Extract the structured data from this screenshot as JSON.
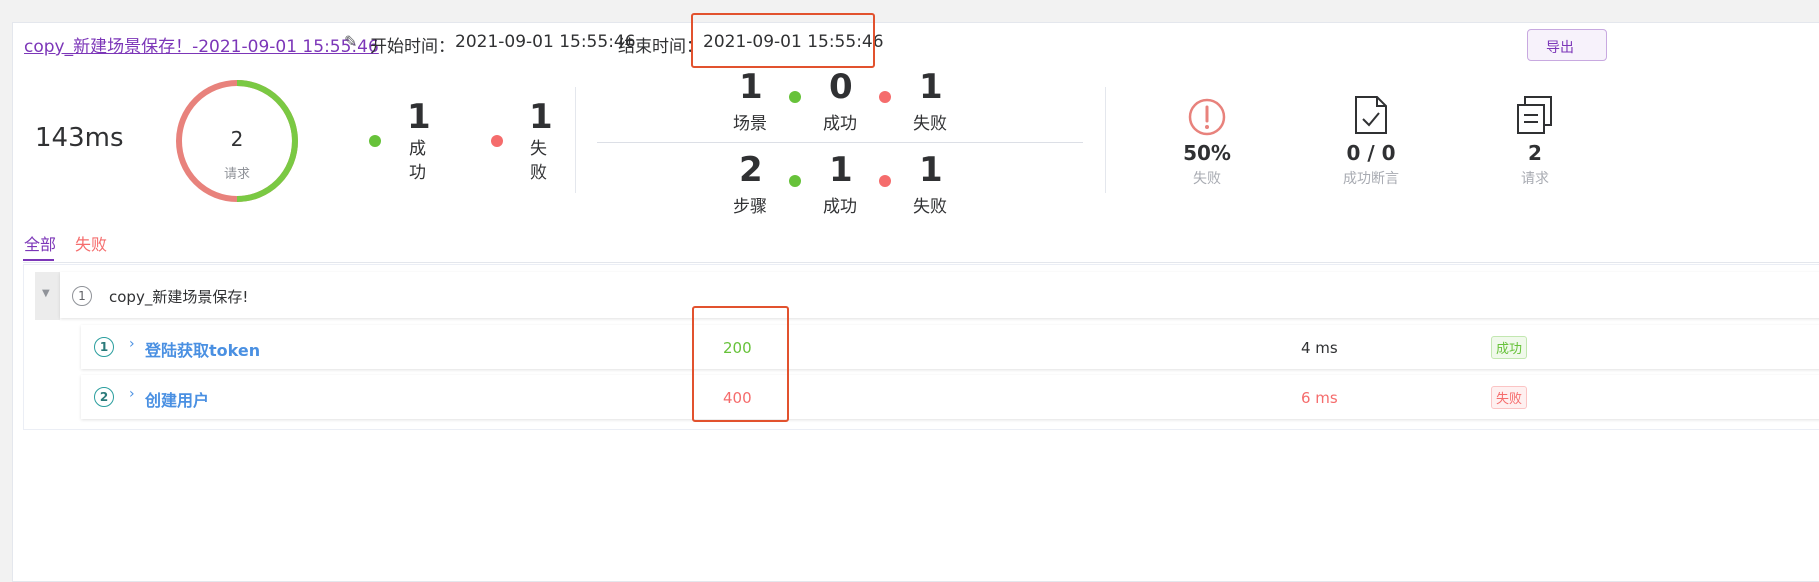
{
  "header": {
    "report_title": "copy_新建场景保存！-2021-09-01 15:55:46 ",
    "start_label": "开始时间：",
    "start_value": "2021-09-01 15:55:46",
    "end_label": "结束时间：",
    "end_value": "2021-09-01 15:55:46",
    "export_label": "导出"
  },
  "summary": {
    "total_time": "143ms",
    "ring": {
      "count": "2",
      "label": "请求",
      "success_fraction": 0.5
    },
    "success_count": "1",
    "success_label": "成功",
    "fail_count": "1",
    "fail_label": "失败"
  },
  "scenario_stats": {
    "scenario_total": "1",
    "scenario_label": "场景",
    "scenario_success": "0",
    "scenario_success_label": "成功",
    "scenario_fail": "1",
    "scenario_fail_label": "失败",
    "step_total": "2",
    "step_label": "步骤",
    "step_success": "1",
    "step_success_label": "成功",
    "step_fail": "1",
    "step_fail_label": "失败"
  },
  "right_stats": {
    "fail_rate": "50%",
    "fail_rate_label": "失败",
    "assertions": "0 / 0",
    "assertions_label": "成功断言",
    "requests": "2",
    "requests_label": "请求"
  },
  "tabs": {
    "all": "全部",
    "fail": "失败"
  },
  "scenario": {
    "index": "1",
    "name": "copy_新建场景保存!"
  },
  "steps": [
    {
      "index": "1",
      "name": "登陆获取token",
      "code": "200",
      "time": "4 ms",
      "status": "成功"
    },
    {
      "index": "2",
      "name": "创建用户",
      "code": "400",
      "time": "6 ms",
      "status": "失败"
    }
  ],
  "colors": {
    "accent": "#7c36b8",
    "success": "#67c23a",
    "fail": "#f56c6c",
    "highlight": "#e2522e"
  },
  "icons": [
    "edit-icon",
    "alert-circle-icon",
    "clipboard-check-icon",
    "copy-docs-icon",
    "caret-down-icon",
    "chevron-right-icon"
  ]
}
